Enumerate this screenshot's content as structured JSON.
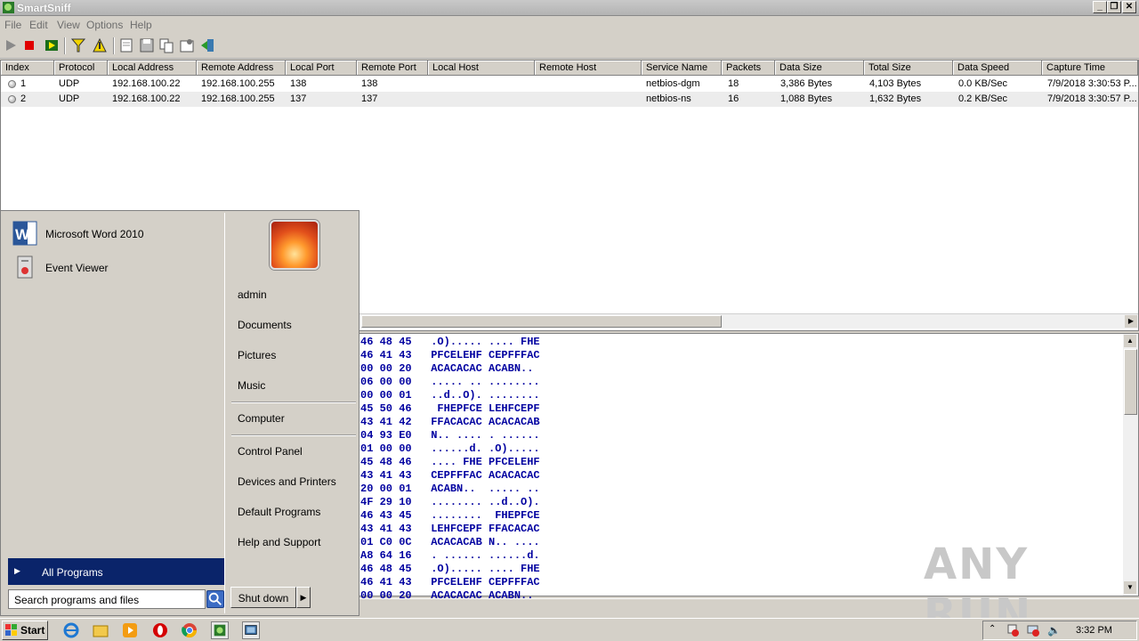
{
  "window": {
    "title": "SmartSniff",
    "min": "_",
    "max": "❐",
    "close": "✕"
  },
  "menu": [
    "File",
    "Edit",
    "View",
    "Options",
    "Help"
  ],
  "columns": [
    "Index",
    "Protocol",
    "Local Address",
    "Remote Address",
    "Local Port",
    "Remote Port",
    "Local Host",
    "Remote Host",
    "Service Name",
    "Packets",
    "Data Size",
    "Total Size",
    "Data Speed",
    "Capture Time"
  ],
  "rows": [
    {
      "index": "1",
      "protocol": "UDP",
      "local_address": "192.168.100.22",
      "remote_address": "192.168.100.255",
      "local_port": "138",
      "remote_port": "138",
      "local_host": "",
      "remote_host": "",
      "service_name": "netbios-dgm",
      "packets": "18",
      "data_size": "3,386 Bytes",
      "total_size": "4,103 Bytes",
      "data_speed": "0.0 KB/Sec",
      "capture_time": "7/9/2018 3:30:53 P..."
    },
    {
      "index": "2",
      "protocol": "UDP",
      "local_address": "192.168.100.22",
      "remote_address": "192.168.100.255",
      "local_port": "137",
      "remote_port": "137",
      "local_host": "",
      "remote_host": "",
      "service_name": "netbios-ns",
      "packets": "16",
      "data_size": "1,088 Bytes",
      "total_size": "1,632 Bytes",
      "data_speed": "0.2 KB/Sec",
      "capture_time": "7/9/2018 3:30:57 P..."
    }
  ],
  "hex_lines": [
    "46 48 45   .O)..... .... FHE",
    "46 41 43   PFCELEHF CEPFFFAC",
    "00 00 20   ACACACAC ACABN..",
    "06 00 00   ..... .. ........",
    "00 00 01   ..d..O). ........",
    "45 50 46    FHEPFCE LEHFCEPF",
    "43 41 42   FFACACAC ACACACAB",
    "04 93 E0   N.. .... . ......",
    "01 00 00   ......d. .O).....",
    "45 48 46   .... FHE PFCELEHF",
    "43 41 43   CEPFFFAC ACACACAC",
    "20 00 01   ACABN..  ..... ..",
    "4F 29 10   ........ ..d..O).",
    "46 43 45   ........  FHEPFCE",
    "43 41 43   LEHFCEPF FFACACAC",
    "01 C0 0C   ACACACAB N.. ....",
    "A8 64 16   . ...... ......d.",
    "46 48 45   .O)..... .... FHE",
    "46 41 43   PFCELEHF CEPFFFAC",
    "00 00 20   ACACACAC ACABN.."
  ],
  "start_menu": {
    "pinned": [
      {
        "label": "Microsoft Word 2010",
        "icon": "word-icon"
      },
      {
        "label": "Event Viewer",
        "icon": "event-viewer-icon"
      }
    ],
    "all_programs": "All Programs",
    "search_placeholder": "Search programs and files",
    "user": "admin",
    "right_items": [
      "Documents",
      "Pictures",
      "Music",
      "Computer",
      "Control Panel",
      "Devices and Printers",
      "Default Programs",
      "Help and Support"
    ],
    "shutdown": "Shut down"
  },
  "taskbar": {
    "start": "Start",
    "clock": "3:32 PM"
  },
  "watermark": "ANY RUN"
}
